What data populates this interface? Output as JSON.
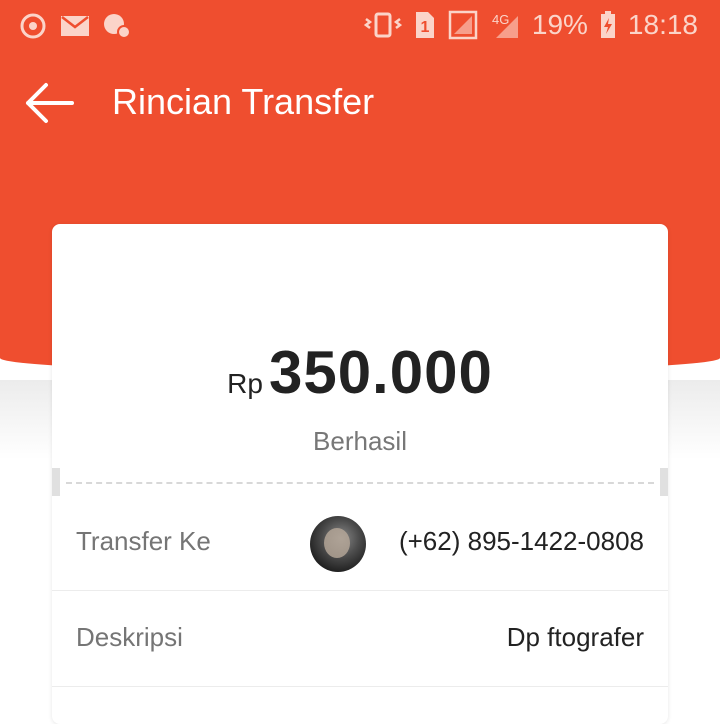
{
  "status_bar": {
    "battery": "19%",
    "time": "18:18",
    "sim": "1",
    "network": "4G",
    "icons": [
      "sync-icon",
      "mail-icon",
      "notification-icon",
      "vibrate-icon",
      "sim-icon",
      "signal-icon",
      "battery-charging-icon"
    ]
  },
  "app_bar": {
    "title": "Rincian Transfer",
    "back_icon": "arrow-left-icon"
  },
  "summary": {
    "currency": "Rp",
    "amount": "350.000",
    "status": "Berhasil"
  },
  "details": [
    {
      "label": "Transfer Ke",
      "value": "(+62) 895-1422-0808",
      "has_avatar": true
    },
    {
      "label": "Deskripsi",
      "value": "Dp ftografer"
    }
  ],
  "colors": {
    "brand": "#ef4e2f",
    "text_primary": "#222222",
    "text_secondary": "#757575"
  }
}
